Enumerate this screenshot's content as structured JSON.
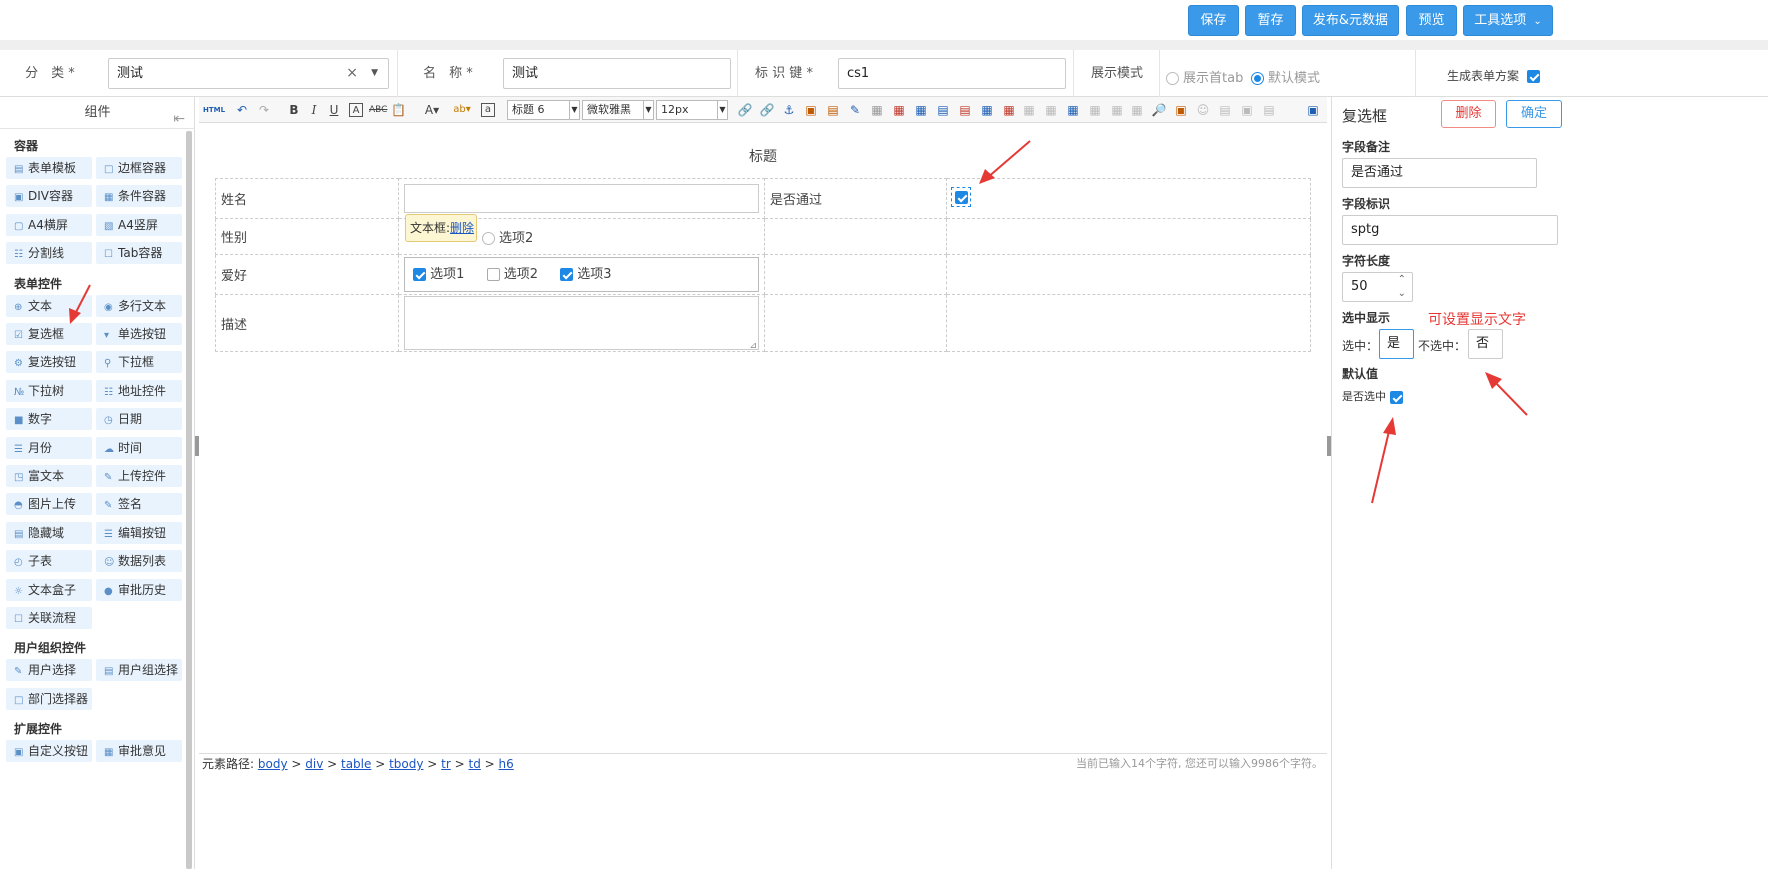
{
  "toolbar": {
    "save": "保存",
    "draft": "暂存",
    "publish": "发布&元数据",
    "preview": "预览",
    "tools": "工具选项"
  },
  "form_header": {
    "category_label": "分　类 *",
    "category_value": "测试",
    "name_label": "名　称 *",
    "name_value": "测试",
    "key_label": "标 识 键 *",
    "key_value": "cs1",
    "mode_label": "展示模式",
    "mode_options": [
      "展示首tab",
      "默认模式"
    ],
    "generate_label": "生成表单方案"
  },
  "left_panel": {
    "title": "组件",
    "sections": [
      {
        "title": "容器",
        "items": [
          "表单模板",
          "边框容器",
          "DIV容器",
          "条件容器",
          "A4横屏",
          "A4竖屏",
          "分割线",
          "Tab容器"
        ]
      },
      {
        "title": "表单控件",
        "items": [
          "文本",
          "多行文本",
          "复选框",
          "单选按钮",
          "复选按钮",
          "下拉框",
          "下拉树",
          "地址控件",
          "数字",
          "日期",
          "月份",
          "时间",
          "富文本",
          "上传控件",
          "图片上传",
          "签名",
          "隐藏域",
          "编辑按钮",
          "子表",
          "数据列表",
          "文本盒子",
          "审批历史",
          "关联流程"
        ]
      },
      {
        "title": "用户组织控件",
        "items": [
          "用户选择",
          "用户组选择",
          "部门选择器"
        ]
      },
      {
        "title": "扩展控件",
        "items": [
          "自定义按钮",
          "审批意见"
        ]
      }
    ]
  },
  "editor_toolbar": {
    "html": "HTML",
    "heading": "标题 6",
    "font": "微软雅黑",
    "size": "12px"
  },
  "editor": {
    "title": "标题",
    "rows": [
      {
        "label": "姓名",
        "label2": "是否通过"
      },
      {
        "label": "性别",
        "label2": ""
      },
      {
        "label": "爱好",
        "label2": ""
      },
      {
        "label": "描述",
        "label2": ""
      }
    ],
    "radio_option": "选项2",
    "checkbox_options": [
      "选项1",
      "选项2",
      "选项3"
    ],
    "checkbox_checked": [
      true,
      false,
      true
    ],
    "tooltip_text": "文本框:",
    "tooltip_link": "删除"
  },
  "status_bar": {
    "path_label": "元素路径:",
    "path": [
      "body",
      "div",
      "table",
      "tbody",
      "tr",
      "td",
      "h6"
    ],
    "count_text": "当前已输入14个字符, 您还可以输入9986个字符。"
  },
  "right_panel": {
    "title": "复选框",
    "delete": "删除",
    "confirm": "确定",
    "field_note_label": "字段备注",
    "field_note_value": "是否通过",
    "field_key_label": "字段标识",
    "field_key_value": "sptg",
    "length_label": "字符长度",
    "length_value": "50",
    "display_label": "选中显示",
    "checked_label": "选中：",
    "checked_value": "是",
    "unchecked_label": "不选中：",
    "unchecked_value": "否",
    "annotation": "可设置显示文字",
    "default_label": "默认值",
    "default_checked_label": "是否选中"
  },
  "colors": {
    "primary": "#3a99e8",
    "annotation_red": "#e53935",
    "component_bg": "#e9f3fd"
  }
}
